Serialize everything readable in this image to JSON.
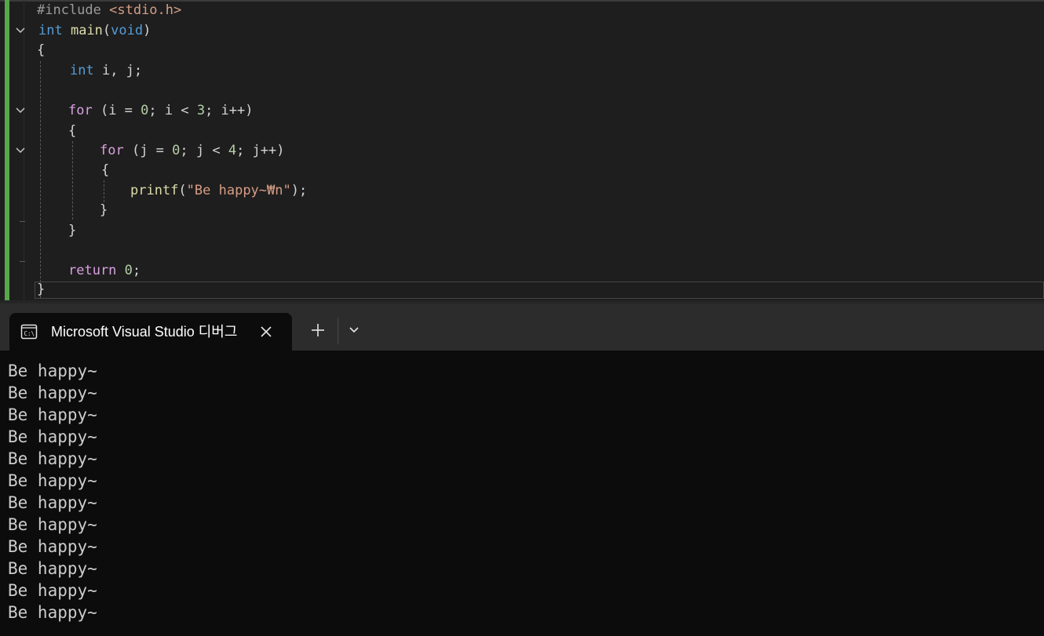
{
  "editor": {
    "lines": [
      {
        "tokens": [
          [
            "#include ",
            "pre"
          ],
          [
            "<stdio.h>",
            "incl"
          ]
        ]
      },
      {
        "tokens": [
          [
            "int ",
            "kw-blue"
          ],
          [
            "main",
            "fn"
          ],
          [
            "(",
            "plain"
          ],
          [
            "void",
            "kw-blue"
          ],
          [
            ")",
            "plain"
          ]
        ]
      },
      {
        "tokens": [
          [
            "{",
            "plain"
          ]
        ]
      },
      {
        "tokens": [
          [
            "int ",
            "kw-blue"
          ],
          [
            "i, j;",
            "plain"
          ]
        ]
      },
      {
        "tokens": []
      },
      {
        "tokens": [
          [
            "for ",
            "kw-purple"
          ],
          [
            "(i = ",
            "plain"
          ],
          [
            "0",
            "num"
          ],
          [
            "; i < ",
            "plain"
          ],
          [
            "3",
            "num"
          ],
          [
            "; i++)",
            "plain"
          ]
        ]
      },
      {
        "tokens": [
          [
            "{",
            "plain"
          ]
        ]
      },
      {
        "tokens": [
          [
            "for ",
            "kw-purple"
          ],
          [
            "(j = ",
            "plain"
          ],
          [
            "0",
            "num"
          ],
          [
            "; j < ",
            "plain"
          ],
          [
            "4",
            "num"
          ],
          [
            "; j++)",
            "plain"
          ]
        ]
      },
      {
        "tokens": [
          [
            "{",
            "plain"
          ]
        ]
      },
      {
        "tokens": [
          [
            "printf",
            "fn"
          ],
          [
            "(",
            "plain"
          ],
          [
            "\"Be happy~₩n\"",
            "str"
          ],
          [
            ");",
            "plain"
          ]
        ]
      },
      {
        "tokens": [
          [
            "}",
            "plain"
          ]
        ]
      },
      {
        "tokens": [
          [
            "}",
            "plain"
          ]
        ]
      },
      {
        "tokens": []
      },
      {
        "tokens": [
          [
            "return ",
            "kw-purple"
          ],
          [
            "0",
            "num"
          ],
          [
            ";",
            "plain"
          ]
        ]
      },
      {
        "tokens": [
          [
            "}",
            "plain"
          ]
        ]
      }
    ]
  },
  "terminal": {
    "tab_title": "Microsoft Visual Studio 디버그",
    "tab_icon": "console-icon",
    "close_icon": "close-icon",
    "new_tab_icon": "plus-icon",
    "dropdown_icon": "chevron-down-icon",
    "output": [
      "Be happy~",
      "Be happy~",
      "Be happy~",
      "Be happy~",
      "Be happy~",
      "Be happy~",
      "Be happy~",
      "Be happy~",
      "Be happy~",
      "Be happy~",
      "Be happy~",
      "Be happy~"
    ]
  }
}
